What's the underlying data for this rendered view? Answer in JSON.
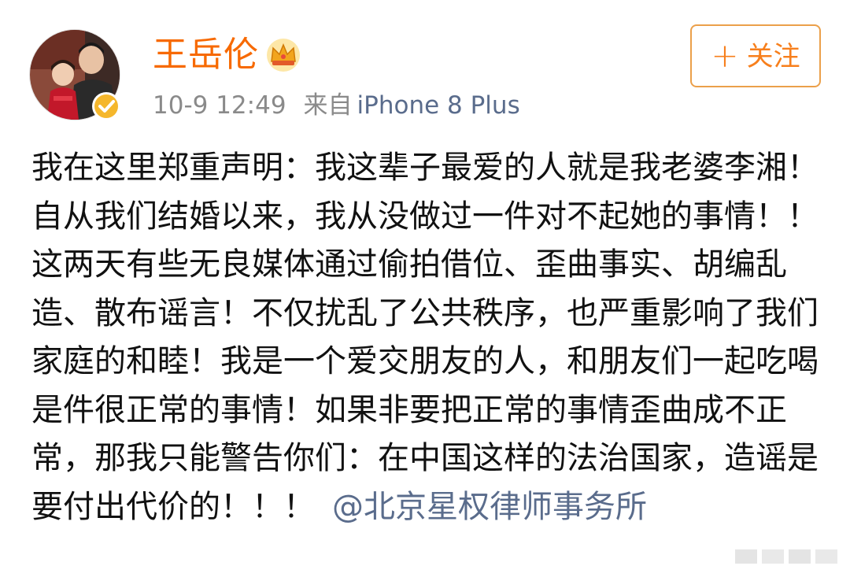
{
  "user": {
    "name": "王岳伦",
    "avatar_icon": "avatar-photo",
    "verified_icon": "verified-badge-icon",
    "vip_icon": "crown-icon",
    "accent_color": "#f76900"
  },
  "meta": {
    "time": "10-9 12:49",
    "source_prefix": "来自",
    "device": "iPhone 8 Plus"
  },
  "follow_button": {
    "plus": "+",
    "label": "关注",
    "border_color": "#eba04a",
    "text_color": "#f77f1c"
  },
  "post": {
    "text": "我在这里郑重声明：我这辈子最爱的人就是我老婆李湘！自从我们结婚以来，我从没做过一件对不起她的事情！！这两天有些无良媒体通过偷拍借位、歪曲事实、胡编乱造、散布谣言！不仅扰乱了公共秩序，也严重影响了我们家庭的和睦！我是一个爱交朋友的人，和朋友们一起吃喝是件很正常的事情！如果非要把正常的事情歪曲成不正常，那我只能警告你们：在中国这样的法治国家，造谣是要付出代价的！！！",
    "mention": "@北京星权律师事务所",
    "mention_color": "#5a6c8c"
  }
}
